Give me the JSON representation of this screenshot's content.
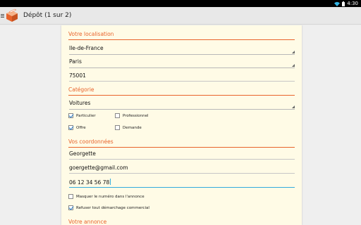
{
  "status_bar": {
    "time": "4:30",
    "wifi_icon": "wifi-icon",
    "battery_icon": "battery-icon"
  },
  "action_bar": {
    "title": "Dépôt (1 sur 2)",
    "menu_icon": "nav-drawer-icon",
    "logo_icon": "app-logo-icon"
  },
  "location": {
    "header": "Votre localisation",
    "region": "Ile-de-France",
    "city": "Paris",
    "postcode": "75001"
  },
  "category": {
    "header": "Catégorie",
    "value": "Voitures",
    "options": [
      {
        "label": "Particulier",
        "checked": true
      },
      {
        "label": "Professionnel",
        "checked": false
      },
      {
        "label": "Offre",
        "checked": true
      },
      {
        "label": "Demande",
        "checked": false
      }
    ]
  },
  "contact": {
    "header": "Vos coordonnées",
    "name": "Georgette",
    "email": "goergette@gmail.com",
    "phone": "06 12 34 56 78",
    "options": [
      {
        "label": "Masquer le numéro dans l'annonce",
        "checked": false
      },
      {
        "label": "Refuser tout démarchage commercial",
        "checked": true
      }
    ]
  },
  "ad": {
    "header": "Votre annonce"
  },
  "colors": {
    "accent": "#e8632b",
    "panel": "#fffbe6",
    "focus": "#33aadd",
    "check": "#2c7fc8"
  }
}
